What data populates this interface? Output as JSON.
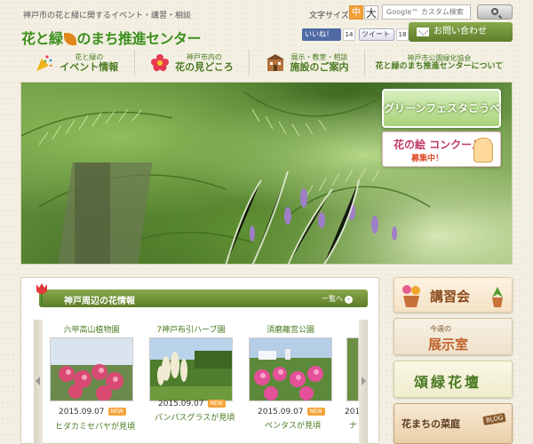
{
  "header": {
    "tagline": "神戸市の花と緑に関するイベント・講習・相談",
    "logo_part1": "花と緑",
    "logo_part2": "のまち推進センター",
    "text_size_label": "文字サイズ",
    "text_size_medium": "中",
    "text_size_large": "大",
    "search_placeholder": "Google™ カスタム検索",
    "fb_like": "いいね！",
    "fb_count": "14",
    "tweet": "ツイート",
    "tweet_count": "18",
    "contact": "お問い合わせ"
  },
  "nav": [
    {
      "small": "花と緑の",
      "big": "イベント情報"
    },
    {
      "small": "神戸市内の",
      "big": "花の見どころ"
    },
    {
      "small": "展示・教室・相談",
      "big": "施設のご案内"
    },
    {
      "small": "神戸市公園緑化協会",
      "big": "花と緑のまち推進センターについて"
    }
  ],
  "hero": {
    "banner_green": "グリーンフェスタこうべ",
    "banner_flower_title": "花の絵 コンクール",
    "banner_flower_sub": "募集中！"
  },
  "flower_info": {
    "title": "神戸周辺の花情報",
    "more": "一覧へ",
    "more_arrow": "›",
    "cards": [
      {
        "place": "六甲高山植物園",
        "date": "2015.09.07",
        "badge": "NEW",
        "caption": "ヒダカミセバヤが見頃"
      },
      {
        "place": "7神戸布引ハーブ園",
        "date": "2015.09.07",
        "badge": "NEW",
        "caption": "パンパスグラスが見頃"
      },
      {
        "place": "須磨離宮公園",
        "date": "2015.09.07",
        "badge": "NEW",
        "caption": "ペンタスが見頃"
      },
      {
        "place": "",
        "date": "201",
        "badge": "",
        "caption": "ナ"
      }
    ]
  },
  "side_banners": {
    "b1": "講習会",
    "b2_small": "今週の",
    "b2_big": "展示室",
    "b3": "頌緑花壇",
    "b4": "花まちの菜庭",
    "b4_tag": "BLOG"
  }
}
